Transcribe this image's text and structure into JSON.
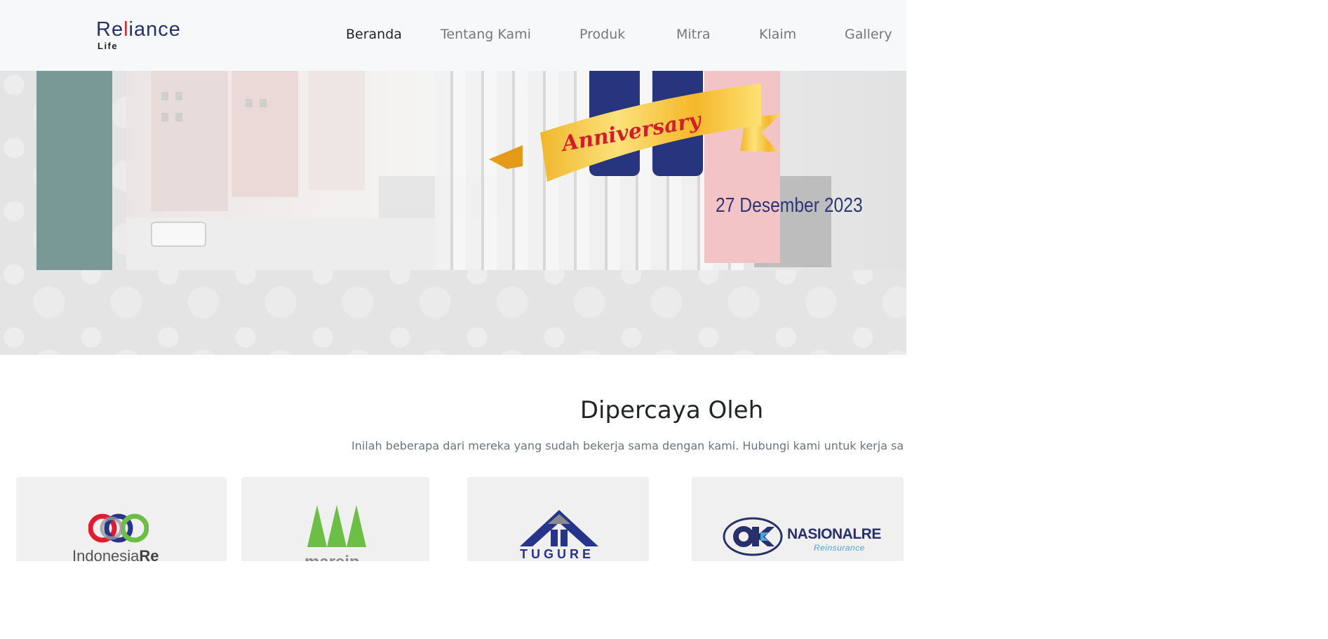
{
  "brand": {
    "logo_prefix": "Re",
    "logo_accent": "l",
    "logo_suffix": "iance",
    "logo_sub": "Life",
    "primary_color": "#27306b",
    "accent_color": "#d3222a"
  },
  "nav": {
    "items": [
      {
        "label": "Beranda",
        "active": true
      },
      {
        "label": "Tentang Kami",
        "active": false
      },
      {
        "label": "Produk",
        "active": false
      },
      {
        "label": "Mitra",
        "active": false
      },
      {
        "label": "Klaim",
        "active": false
      },
      {
        "label": "Gallery",
        "active": false
      }
    ]
  },
  "hero": {
    "ribbon_text": "Anniversary",
    "date": "27 Desember 2023"
  },
  "trusted": {
    "title": "Dipercaya Oleh",
    "subtitle": "Inilah beberapa dari mereka yang sudah bekerja sama dengan kami. Hubungi kami untuk kerja sa",
    "partners": [
      {
        "name_part1": "Indonesia",
        "name_part2": "Re"
      },
      {
        "name": "marein"
      },
      {
        "name": "TUGURE"
      },
      {
        "name": "NASIONALRE",
        "tagline": "Reinsurance"
      }
    ]
  }
}
